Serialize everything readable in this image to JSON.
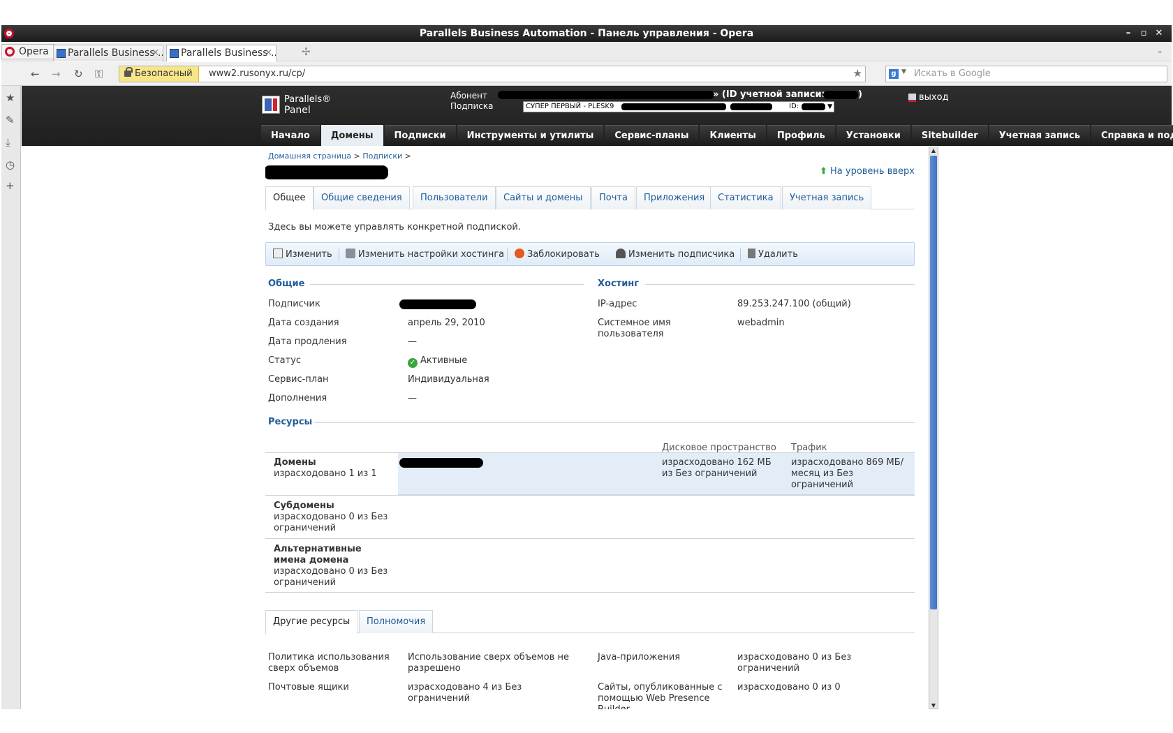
{
  "window": {
    "title": "Parallels Business Automation - Панель управления - Opera"
  },
  "browser": {
    "opera_label": "Opera",
    "tabs": [
      {
        "label": "Parallels Business ..."
      },
      {
        "label": "Parallels Business ..."
      }
    ],
    "secure_label": "Безопасный",
    "url": "www2.rusonyx.ru/cp/",
    "search_placeholder": "Искать в Google"
  },
  "header": {
    "logo_line1": "Parallels®",
    "logo_line2": "Panel",
    "subscriber_label": "Абонент",
    "account_id_label": "» (ID учетной записи:",
    "subscription_label": "Подписка",
    "subscription_value": "СУПЕР ПЕРВЫЙ - PLESK9",
    "subscription_id_label": "ID:",
    "logout": "выход",
    "menu": [
      "Начало",
      "Домены",
      "Подписки",
      "Инструменты и утилиты",
      "Сервис-планы",
      "Клиенты",
      "Профиль",
      "Установки",
      "Sitebuilder",
      "Учетная запись",
      "Справка и под"
    ]
  },
  "breadcrumb": {
    "home": "Домашняя страница",
    "subscriptions": "Подписки"
  },
  "up_link": "На уровень вверх",
  "tabs": [
    "Общее",
    "Общие сведения",
    "Пользователи",
    "Сайты и домены",
    "Почта",
    "Приложения",
    "Статистика",
    "Учетная запись"
  ],
  "intro": "Здесь вы можете управлять конкретной подпиской.",
  "toolbar": {
    "edit": "Изменить",
    "hosting": "Изменить настройки хостинга",
    "block": "Заблокировать",
    "change_subscriber": "Изменить подписчика",
    "delete": "Удалить"
  },
  "general": {
    "title": "Общие",
    "subscriber_label": "Подписчик",
    "created_label": "Дата создания",
    "created_value": "апрель 29, 2010",
    "renewal_label": "Дата продления",
    "renewal_value": "—",
    "status_label": "Статус",
    "status_value": "Активные",
    "plan_label": "Сервис-план",
    "plan_value": "Индивидуальная",
    "addons_label": "Дополнения",
    "addons_value": "—"
  },
  "hosting": {
    "title": "Хостинг",
    "ip_label": "IP-адрес",
    "ip_value": "89.253.247.100 (общий)",
    "sysuser_label": "Системное имя пользователя",
    "sysuser_value": "webadmin"
  },
  "resources": {
    "title": "Ресурсы",
    "col_disk": "Дисковое пространство",
    "col_traffic": "Трафик",
    "domains_title": "Домены",
    "domains_used": "израсходовано 1 из 1",
    "domain_disk": "израсходовано 162 МБ из Без ограничений",
    "domain_traffic": "израсходовано 869 МБ/месяц из Без ограничений",
    "subdomains_title": "Субдомены",
    "subdomains_used": "израсходовано 0 из Без ограничений",
    "aliases_title": "Альтернативные имена домена",
    "aliases_used": "израсходовано 0 из Без ограничений"
  },
  "bottom_tabs": [
    "Другие ресурсы",
    "Полномочия"
  ],
  "other": {
    "overuse_label": "Политика использования сверх объемов",
    "overuse_value": "Использование сверх объемов не разрешено",
    "java_label": "Java-приложения",
    "java_value": "израсходовано 0 из Без ограничений",
    "mailboxes_label": "Почтовые ящики",
    "mailboxes_value": "израсходовано 4 из Без ограничений",
    "wpb_label": "Сайты, опубликованные с помощью Web Presence Builder",
    "wpb_value": "израсходовано 0 из 0"
  }
}
